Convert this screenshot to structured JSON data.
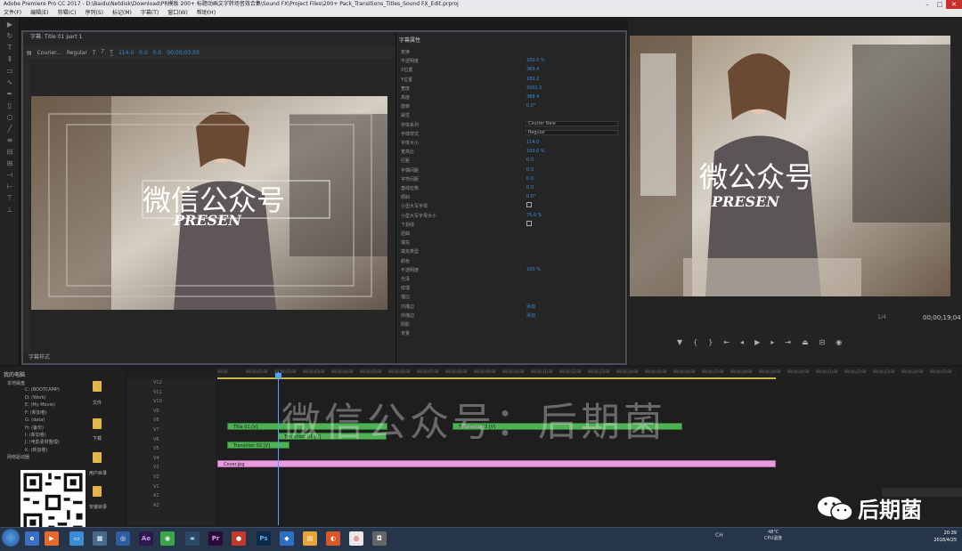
{
  "window": {
    "title": "Adobe Premiere Pro CC 2017 - D:\\Baidu\\Netdisk\\Download\\PR模板 200+ 标题动画文字转场音效合集\\Sound FX\\Project Files\\200+ Pack_Transitions_Titles_Sound FX_Edit.prproj"
  },
  "menu": [
    "文件(F)",
    "编辑(E)",
    "剪辑(C)",
    "序列(S)",
    "标记(M)",
    "字幕(T)",
    "窗口(W)",
    "帮助(H)"
  ],
  "titler": {
    "tab_label": "字幕: Title 01 part 1",
    "font_family": "Courier...",
    "font_style": "Regular",
    "font_size": "114.0",
    "kerning": "0.0",
    "leading": "0.0",
    "timecode": "00;00;03;03",
    "footer_label": "字幕样式",
    "canvas_title": "微信公众号",
    "canvas_subtitle": "PRESEN"
  },
  "properties": {
    "panel_title": "字幕属性",
    "rows": [
      {
        "label": "变换",
        "value": ""
      },
      {
        "label": "不透明度",
        "value": "100.0 %"
      },
      {
        "label": "X位置",
        "value": "369.4"
      },
      {
        "label": "Y位置",
        "value": "189.2"
      },
      {
        "label": "宽度",
        "value": "2002.0"
      },
      {
        "label": "高度",
        "value": "388.4"
      },
      {
        "label": "旋转",
        "value": "0.0°"
      },
      {
        "label": "属性",
        "value": ""
      },
      {
        "label": "字体系列",
        "value": "Courier New"
      },
      {
        "label": "字体样式",
        "value": "Regular"
      },
      {
        "label": "字体大小",
        "value": "114.0"
      },
      {
        "label": "宽高比",
        "value": "100.0 %"
      },
      {
        "label": "行距",
        "value": "0.0"
      },
      {
        "label": "字偶间距",
        "value": "0.0"
      },
      {
        "label": "字符间距",
        "value": "0.0"
      },
      {
        "label": "基线位移",
        "value": "0.0"
      },
      {
        "label": "倾斜",
        "value": "0.0°"
      },
      {
        "label": "小型大写字母",
        "value": ""
      },
      {
        "label": "小型大写字母大小",
        "value": "75.0 %"
      },
      {
        "label": "下划线",
        "value": ""
      },
      {
        "label": "扭曲",
        "value": ""
      },
      {
        "label": "填充",
        "value": ""
      },
      {
        "label": "填充类型",
        "value": ""
      },
      {
        "label": "颜色",
        "value": ""
      },
      {
        "label": "不透明度",
        "value": "100 %"
      },
      {
        "label": "光泽",
        "value": ""
      },
      {
        "label": "纹理",
        "value": ""
      },
      {
        "label": "描边",
        "value": ""
      },
      {
        "label": "内描边",
        "value": "添加"
      },
      {
        "label": "外描边",
        "value": "添加"
      },
      {
        "label": "阴影",
        "value": ""
      },
      {
        "label": "背景",
        "value": ""
      }
    ]
  },
  "program": {
    "fit_label": "1/4",
    "timecode": "00;00;19;04",
    "canvas_title": "微公众号",
    "canvas_subtitle": "PRESEN"
  },
  "project": {
    "title": "我的电脑",
    "tree": [
      "本地磁盘",
      "C: (BOOTCAMP)",
      "D: (Work)",
      "E: (My Movie)",
      "F: (新加卷)",
      "G: (data)",
      "H: (备份)",
      "I: (新加卷)",
      "J: (电影素材整理)",
      "K: (新加卷)",
      "网络驱动器"
    ],
    "folders": [
      "文件",
      "下载",
      "用户目录",
      "安装目录"
    ]
  },
  "timeline": {
    "tracks": [
      "V12",
      "V11",
      "V10",
      "V9",
      "V8",
      "V7",
      "V6",
      "V5",
      "V4",
      "V3",
      "V2",
      "V1",
      "A1",
      "A2"
    ],
    "ruler": [
      "00;00",
      "00;00;01;00",
      "00;00;02;00",
      "00;00;03;00",
      "00;00;04;00",
      "00;00;05;00",
      "00;00;06;00",
      "00;00;07;00",
      "00;00;08;00",
      "00;00;09;00",
      "00;00;10;00",
      "00;00;11;00",
      "00;00;12;00",
      "00;00;13;00",
      "00;00;14;00",
      "00;00;15;00",
      "00;00;16;00",
      "00;00;17;00",
      "00;00;18;00",
      "00;00;19;00",
      "00;00;20;00",
      "00;00;21;00",
      "00;00;22;00",
      "00;00;23;00",
      "00;00;24;00",
      "00;00;25;00"
    ],
    "clips": [
      {
        "label": "Title 01 [V]"
      },
      {
        "label": "Transition 01 [V]"
      },
      {
        "label": "Transition 02 [V]"
      },
      {
        "label": "Transition 03 [V]"
      },
      {
        "label": "Cover.jpg"
      }
    ],
    "watermark": "微信公众号：后期菌"
  },
  "brand": {
    "name": "后期菌"
  },
  "taskbar": {
    "temp": "48℃",
    "cpu_label": "CPU温度",
    "time": "20:39",
    "date": "2018/4/25",
    "lang": "CH"
  },
  "colors": {
    "accent": "#3b8bd6",
    "clip_green": "#4fb054",
    "clip_pink": "#e79be0",
    "playhead": "#4da3ff"
  }
}
